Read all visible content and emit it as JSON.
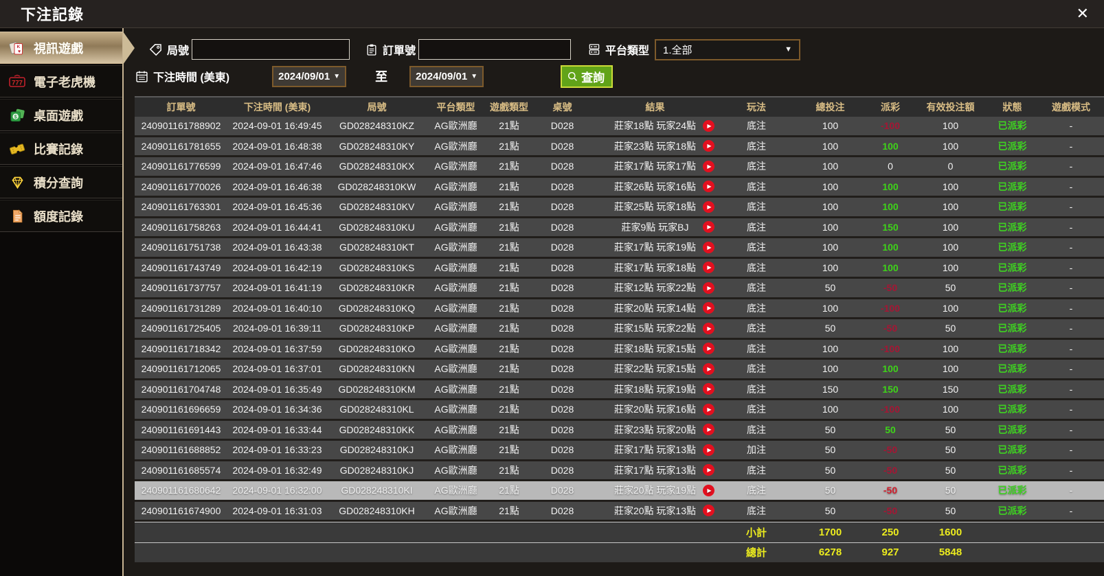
{
  "window": {
    "title": "下注記錄",
    "close_label": "✕"
  },
  "sidebar": {
    "items": [
      {
        "label": "視訊遊戲",
        "icon": "playing-cards-icon",
        "selected": true
      },
      {
        "label": "電子老虎機",
        "icon": "slot-777-icon",
        "selected": false
      },
      {
        "label": "桌面遊戲",
        "icon": "table-games-icon",
        "selected": false
      },
      {
        "label": "比賽記錄",
        "icon": "ticket-icon",
        "selected": false
      },
      {
        "label": "積分查詢",
        "icon": "diamond-icon",
        "selected": false
      },
      {
        "label": "額度記錄",
        "icon": "document-icon",
        "selected": false
      }
    ]
  },
  "filters": {
    "round_label": "局號",
    "round_value": "",
    "order_label": "訂單號",
    "order_value": "",
    "platform_label": "平台類型",
    "platform_value": "1.全部",
    "time_label": "下注時間 (美東)",
    "date_from": "2024/09/01",
    "to_label": "至",
    "date_to": "2024/09/01",
    "search_label": "查詢"
  },
  "table": {
    "columns": [
      "訂單號",
      "下注時間 (美東)",
      "局號",
      "平台類型",
      "遊戲類型",
      "桌號",
      "結果",
      "玩法",
      "總投注",
      "派彩",
      "有效投注額",
      "狀態",
      "遊戲模式"
    ],
    "rows": [
      {
        "id": "240901161788902",
        "time": "2024-09-01 16:49:45",
        "round": "GD028248310KZ",
        "platform": "AG歐洲廳",
        "game": "21點",
        "table": "D028",
        "result": "莊家18點 玩家24點",
        "bet_type": "底注",
        "total": "100",
        "payout": "-100",
        "valid": "100",
        "status": "已派彩",
        "mode": "-",
        "highlight": false
      },
      {
        "id": "240901161781655",
        "time": "2024-09-01 16:48:38",
        "round": "GD028248310KY",
        "platform": "AG歐洲廳",
        "game": "21點",
        "table": "D028",
        "result": "莊家23點 玩家18點",
        "bet_type": "底注",
        "total": "100",
        "payout": "100",
        "valid": "100",
        "status": "已派彩",
        "mode": "-",
        "highlight": false
      },
      {
        "id": "240901161776599",
        "time": "2024-09-01 16:47:46",
        "round": "GD028248310KX",
        "platform": "AG歐洲廳",
        "game": "21點",
        "table": "D028",
        "result": "莊家17點 玩家17點",
        "bet_type": "底注",
        "total": "100",
        "payout": "0",
        "valid": "0",
        "status": "已派彩",
        "mode": "-",
        "highlight": false
      },
      {
        "id": "240901161770026",
        "time": "2024-09-01 16:46:38",
        "round": "GD028248310KW",
        "platform": "AG歐洲廳",
        "game": "21點",
        "table": "D028",
        "result": "莊家26點 玩家16點",
        "bet_type": "底注",
        "total": "100",
        "payout": "100",
        "valid": "100",
        "status": "已派彩",
        "mode": "-",
        "highlight": false
      },
      {
        "id": "240901161763301",
        "time": "2024-09-01 16:45:36",
        "round": "GD028248310KV",
        "platform": "AG歐洲廳",
        "game": "21點",
        "table": "D028",
        "result": "莊家25點 玩家18點",
        "bet_type": "底注",
        "total": "100",
        "payout": "100",
        "valid": "100",
        "status": "已派彩",
        "mode": "-",
        "highlight": false
      },
      {
        "id": "240901161758263",
        "time": "2024-09-01 16:44:41",
        "round": "GD028248310KU",
        "platform": "AG歐洲廳",
        "game": "21點",
        "table": "D028",
        "result": "莊家9點 玩家BJ",
        "bet_type": "底注",
        "total": "100",
        "payout": "150",
        "valid": "100",
        "status": "已派彩",
        "mode": "-",
        "highlight": false
      },
      {
        "id": "240901161751738",
        "time": "2024-09-01 16:43:38",
        "round": "GD028248310KT",
        "platform": "AG歐洲廳",
        "game": "21點",
        "table": "D028",
        "result": "莊家17點 玩家19點",
        "bet_type": "底注",
        "total": "100",
        "payout": "100",
        "valid": "100",
        "status": "已派彩",
        "mode": "-",
        "highlight": false
      },
      {
        "id": "240901161743749",
        "time": "2024-09-01 16:42:19",
        "round": "GD028248310KS",
        "platform": "AG歐洲廳",
        "game": "21點",
        "table": "D028",
        "result": "莊家17點 玩家18點",
        "bet_type": "底注",
        "total": "100",
        "payout": "100",
        "valid": "100",
        "status": "已派彩",
        "mode": "-",
        "highlight": false
      },
      {
        "id": "240901161737757",
        "time": "2024-09-01 16:41:19",
        "round": "GD028248310KR",
        "platform": "AG歐洲廳",
        "game": "21點",
        "table": "D028",
        "result": "莊家12點 玩家22點",
        "bet_type": "底注",
        "total": "50",
        "payout": "-50",
        "valid": "50",
        "status": "已派彩",
        "mode": "-",
        "highlight": false
      },
      {
        "id": "240901161731289",
        "time": "2024-09-01 16:40:10",
        "round": "GD028248310KQ",
        "platform": "AG歐洲廳",
        "game": "21點",
        "table": "D028",
        "result": "莊家20點 玩家14點",
        "bet_type": "底注",
        "total": "100",
        "payout": "-100",
        "valid": "100",
        "status": "已派彩",
        "mode": "-",
        "highlight": false
      },
      {
        "id": "240901161725405",
        "time": "2024-09-01 16:39:11",
        "round": "GD028248310KP",
        "platform": "AG歐洲廳",
        "game": "21點",
        "table": "D028",
        "result": "莊家15點 玩家22點",
        "bet_type": "底注",
        "total": "50",
        "payout": "-50",
        "valid": "50",
        "status": "已派彩",
        "mode": "-",
        "highlight": false
      },
      {
        "id": "240901161718342",
        "time": "2024-09-01 16:37:59",
        "round": "GD028248310KO",
        "platform": "AG歐洲廳",
        "game": "21點",
        "table": "D028",
        "result": "莊家18點 玩家15點",
        "bet_type": "底注",
        "total": "100",
        "payout": "-100",
        "valid": "100",
        "status": "已派彩",
        "mode": "-",
        "highlight": false
      },
      {
        "id": "240901161712065",
        "time": "2024-09-01 16:37:01",
        "round": "GD028248310KN",
        "platform": "AG歐洲廳",
        "game": "21點",
        "table": "D028",
        "result": "莊家22點 玩家15點",
        "bet_type": "底注",
        "total": "100",
        "payout": "100",
        "valid": "100",
        "status": "已派彩",
        "mode": "-",
        "highlight": false
      },
      {
        "id": "240901161704748",
        "time": "2024-09-01 16:35:49",
        "round": "GD028248310KM",
        "platform": "AG歐洲廳",
        "game": "21點",
        "table": "D028",
        "result": "莊家18點 玩家19點",
        "bet_type": "底注",
        "total": "150",
        "payout": "150",
        "valid": "150",
        "status": "已派彩",
        "mode": "-",
        "highlight": false
      },
      {
        "id": "240901161696659",
        "time": "2024-09-01 16:34:36",
        "round": "GD028248310KL",
        "platform": "AG歐洲廳",
        "game": "21點",
        "table": "D028",
        "result": "莊家20點 玩家16點",
        "bet_type": "底注",
        "total": "100",
        "payout": "-100",
        "valid": "100",
        "status": "已派彩",
        "mode": "-",
        "highlight": false
      },
      {
        "id": "240901161691443",
        "time": "2024-09-01 16:33:44",
        "round": "GD028248310KK",
        "platform": "AG歐洲廳",
        "game": "21點",
        "table": "D028",
        "result": "莊家23點 玩家20點",
        "bet_type": "底注",
        "total": "50",
        "payout": "50",
        "valid": "50",
        "status": "已派彩",
        "mode": "-",
        "highlight": false
      },
      {
        "id": "240901161688852",
        "time": "2024-09-01 16:33:23",
        "round": "GD028248310KJ",
        "platform": "AG歐洲廳",
        "game": "21點",
        "table": "D028",
        "result": "莊家17點 玩家13點",
        "bet_type": "加注",
        "total": "50",
        "payout": "-50",
        "valid": "50",
        "status": "已派彩",
        "mode": "-",
        "highlight": false
      },
      {
        "id": "240901161685574",
        "time": "2024-09-01 16:32:49",
        "round": "GD028248310KJ",
        "platform": "AG歐洲廳",
        "game": "21點",
        "table": "D028",
        "result": "莊家17點 玩家13點",
        "bet_type": "底注",
        "total": "50",
        "payout": "-50",
        "valid": "50",
        "status": "已派彩",
        "mode": "-",
        "highlight": false
      },
      {
        "id": "240901161680642",
        "time": "2024-09-01 16:32:00",
        "round": "GD028248310KI",
        "platform": "AG歐洲廳",
        "game": "21點",
        "table": "D028",
        "result": "莊家20點 玩家19點",
        "bet_type": "底注",
        "total": "50",
        "payout": "-50",
        "valid": "50",
        "status": "已派彩",
        "mode": "-",
        "highlight": true
      },
      {
        "id": "240901161674900",
        "time": "2024-09-01 16:31:03",
        "round": "GD028248310KH",
        "platform": "AG歐洲廳",
        "game": "21點",
        "table": "D028",
        "result": "莊家20點 玩家13點",
        "bet_type": "底注",
        "total": "50",
        "payout": "-50",
        "valid": "50",
        "status": "已派彩",
        "mode": "-",
        "highlight": false
      }
    ],
    "subtotal": {
      "label": "小計",
      "total": "1700",
      "payout": "250",
      "valid": "1600"
    },
    "grand_total": {
      "label": "總計",
      "total": "6278",
      "payout": "927",
      "valid": "5848"
    }
  },
  "colors": {
    "accent_tan": "#c7b493",
    "header_gold": "#d9bd85",
    "payout_negative": "#a51634",
    "payout_positive": "#3ed319",
    "status_green": "#3ed321",
    "summary_yellow": "#ecec1e",
    "search_green": "#61a319",
    "play_red": "#e3101f",
    "highlight_row": "#b9b9b9"
  }
}
